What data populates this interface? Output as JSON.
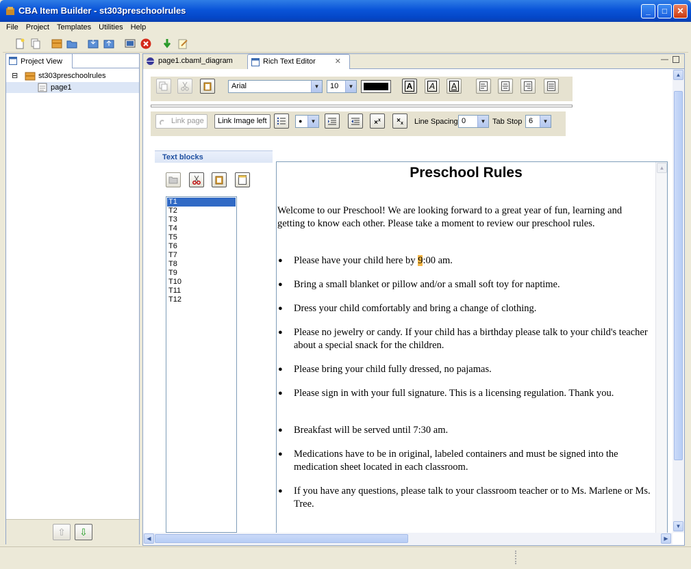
{
  "window": {
    "title": "CBA Item Builder - st303preschoolrules",
    "controls": [
      "_",
      "□",
      "✕"
    ]
  },
  "menu": [
    "File",
    "Project",
    "Templates",
    "Utilities",
    "Help"
  ],
  "project_view": {
    "tab_label": "Project View",
    "tree": {
      "project": "st303preschoolrules",
      "page": "page1",
      "expander": "⊟"
    },
    "up_arrow": "⇧",
    "down_arrow": "⇩"
  },
  "editor_tabs": {
    "diagram": "page1.cbaml_diagram",
    "rich_text": "Rich Text Editor",
    "close": "✕"
  },
  "format_bar": {
    "font": "Arial",
    "size": "10",
    "text_color": "#000000",
    "style_labels": [
      "A",
      "A",
      "A"
    ]
  },
  "format_bar2": {
    "link_page": "Link page",
    "link_image_left": "Link Image left",
    "bullet_value": "●",
    "line_spacing_label": "Line Spacing",
    "line_spacing_value": "0",
    "tab_stop_label": "Tab Stop",
    "tab_stop_value": "6"
  },
  "text_blocks": {
    "header": "Text blocks",
    "items": [
      "T1",
      "T2",
      "T3",
      "T4",
      "T5",
      "T6",
      "T7",
      "T8",
      "T9",
      "T10",
      "T11",
      "T12"
    ],
    "selected": "T1"
  },
  "document": {
    "title": "Preschool Rules",
    "intro": "Welcome to our Preschool! We are looking forward to a great year of fun, learning and getting to know each other. Please take a moment to review our preschool rules.",
    "bullet_char": "●",
    "bullet1_pre": "Please have your child here by ",
    "bullet1_hl": "9",
    "bullet1_post": ":00 am.",
    "bullets": [
      "Bring a small blanket or pillow and/or a small soft toy for naptime.",
      "Dress your child comfortably and bring a change of clothing.",
      "Please no jewelry or candy. If your child has a birthday please talk to your child's teacher about a special snack for the children.",
      "Please bring your child fully dressed, no pajamas.",
      "Please sign in with your full signature. This is a licensing regulation. Thank you.",
      "Breakfast will be served until 7:30 am.",
      "Medications have to be in original, labeled containers and must be signed into the medication sheet located in each classroom.",
      "If you have any questions, please talk to your classroom teacher or to Ms. Marlene or Ms. Tree."
    ]
  },
  "colors": {
    "titlebar": "#0a54d8",
    "selection": "#316ac5",
    "highlight": "#f5b748"
  }
}
